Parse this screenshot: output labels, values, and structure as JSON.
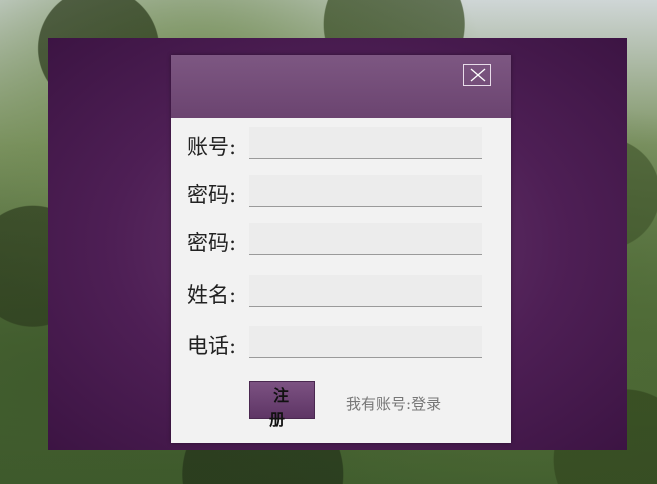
{
  "dialog": {
    "close_label": "×"
  },
  "form": {
    "fields": [
      {
        "label": "账号:",
        "value": ""
      },
      {
        "label": "密码:",
        "value": ""
      },
      {
        "label": "密码:",
        "value": ""
      },
      {
        "label": "姓名:",
        "value": ""
      },
      {
        "label": "电话:",
        "value": ""
      }
    ]
  },
  "actions": {
    "register_label": "注 册",
    "have_account_text": "我有账号:",
    "login_link": "登录"
  },
  "colors": {
    "overlay": "#4e1f55",
    "header": "#744d79",
    "button": "#6b4470"
  }
}
